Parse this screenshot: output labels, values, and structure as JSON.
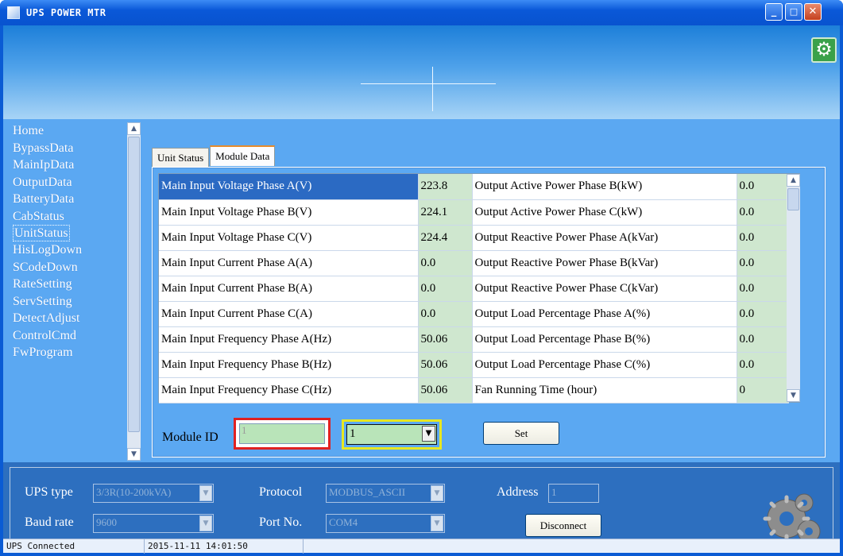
{
  "window": {
    "title": "UPS POWER MTR"
  },
  "sidebar": {
    "items": [
      {
        "label": "Home"
      },
      {
        "label": "BypassData"
      },
      {
        "label": "MainIpData"
      },
      {
        "label": "OutputData"
      },
      {
        "label": "BatteryData"
      },
      {
        "label": "CabStatus"
      },
      {
        "label": "UnitStatus",
        "selected": true
      },
      {
        "label": "HisLogDown"
      },
      {
        "label": "SCodeDown"
      },
      {
        "label": "RateSetting"
      },
      {
        "label": "ServSetting"
      },
      {
        "label": "DetectAdjust"
      },
      {
        "label": "ControlCmd"
      },
      {
        "label": "FwProgram"
      }
    ]
  },
  "tabs": [
    {
      "label": "Unit Status"
    },
    {
      "label": "Module Data",
      "active": true
    }
  ],
  "table": {
    "rows": [
      {
        "l1": "Main Input Voltage Phase A(V)",
        "v1": "223.8",
        "l2": "Output Active Power Phase B(kW)",
        "v2": "0.0"
      },
      {
        "l1": "Main Input Voltage Phase B(V)",
        "v1": "224.1",
        "l2": "Output Active Power Phase C(kW)",
        "v2": "0.0"
      },
      {
        "l1": "Main Input Voltage Phase C(V)",
        "v1": "224.4",
        "l2": "Output Reactive Power Phase A(kVar)",
        "v2": "0.0"
      },
      {
        "l1": "Main Input Current Phase A(A)",
        "v1": "0.0",
        "l2": "Output Reactive Power Phase B(kVar)",
        "v2": "0.0"
      },
      {
        "l1": "Main Input Current Phase B(A)",
        "v1": "0.0",
        "l2": "Output Reactive Power Phase C(kVar)",
        "v2": "0.0"
      },
      {
        "l1": "Main Input Current Phase C(A)",
        "v1": "0.0",
        "l2": "Output Load Percentage Phase A(%)",
        "v2": "0.0"
      },
      {
        "l1": "Main Input Frequency Phase A(Hz)",
        "v1": "50.06",
        "l2": "Output Load Percentage Phase B(%)",
        "v2": "0.0"
      },
      {
        "l1": "Main Input Frequency Phase B(Hz)",
        "v1": "50.06",
        "l2": "Output Load Percentage Phase C(%)",
        "v2": "0.0"
      },
      {
        "l1": "Main Input Frequency Phase C(Hz)",
        "v1": "50.06",
        "l2": "Fan Running Time (hour)",
        "v2": "0"
      }
    ]
  },
  "module": {
    "label": "Module ID",
    "id_value": "1",
    "select_value": "1",
    "set_label": "Set"
  },
  "connection": {
    "ups_type_label": "UPS type",
    "ups_type_value": "3/3R(10-200kVA)",
    "protocol_label": "Protocol",
    "protocol_value": "MODBUS_ASCII",
    "address_label": "Address",
    "address_value": "1",
    "baud_label": "Baud rate",
    "baud_value": "9600",
    "port_label": "Port No.",
    "port_value": "COM4",
    "disconnect_label": "Disconnect"
  },
  "status": {
    "connection": "UPS Connected",
    "datetime": "2015-11-11 14:01:50"
  }
}
